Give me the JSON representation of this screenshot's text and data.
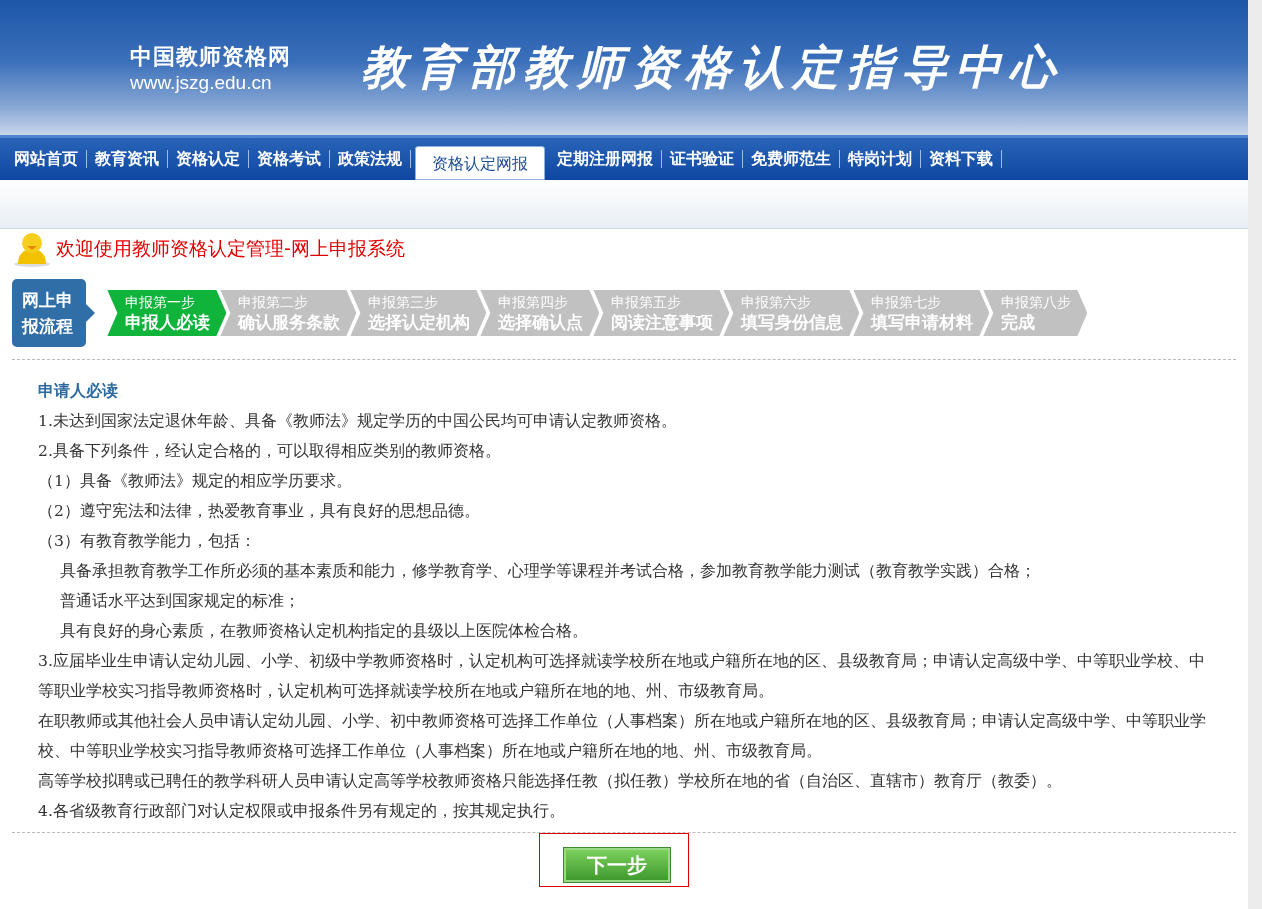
{
  "header": {
    "site_name": "中国教师资格网",
    "site_url": "www.jszg.edu.cn",
    "banner_title": "教育部教师资格认定指导中心"
  },
  "nav": [
    {
      "label": "网站首页",
      "selected": false
    },
    {
      "label": "教育资讯",
      "selected": false
    },
    {
      "label": "资格认定",
      "selected": false
    },
    {
      "label": "资格考试",
      "selected": false
    },
    {
      "label": "政策法规",
      "selected": false
    },
    {
      "label": "资格认定网报",
      "selected": true
    },
    {
      "label": "定期注册网报",
      "selected": false
    },
    {
      "label": "证书验证",
      "selected": false
    },
    {
      "label": "免费师范生",
      "selected": false
    },
    {
      "label": "特岗计划",
      "selected": false
    },
    {
      "label": "资料下载",
      "selected": false
    }
  ],
  "welcome": "欢迎使用教师资格认定管理-网上申报系统",
  "flow_label": "网上申报流程",
  "steps": [
    {
      "step": "申报第一步",
      "title": "申报人必读",
      "selected": true
    },
    {
      "step": "申报第二步",
      "title": "确认服务条款",
      "selected": false
    },
    {
      "step": "申报第三步",
      "title": "选择认定机构",
      "selected": false
    },
    {
      "step": "申报第四步",
      "title": "选择确认点",
      "selected": false
    },
    {
      "step": "申报第五步",
      "title": "阅读注意事项",
      "selected": false
    },
    {
      "step": "申报第六步",
      "title": "填写身份信息",
      "selected": false
    },
    {
      "step": "申报第七步",
      "title": "填写申请材料",
      "selected": false
    },
    {
      "step": "申报第八步",
      "title": "完成",
      "selected": false
    }
  ],
  "notice": [
    {
      "kind": "heading",
      "text": "申请人必读"
    },
    {
      "kind": "para",
      "text": "1.未达到国家法定退休年龄、具备《教师法》规定学历的中国公民均可申请认定教师资格。"
    },
    {
      "kind": "para",
      "text": "2.具备下列条件，经认定合格的，可以取得相应类别的教师资格。"
    },
    {
      "kind": "sub",
      "text": "（1）具备《教师法》规定的相应学历要求。"
    },
    {
      "kind": "sub",
      "text": "（2）遵守宪法和法律，热爱教育事业，具有良好的思想品德。"
    },
    {
      "kind": "sub",
      "text": "（3）有教育教学能力，包括："
    },
    {
      "kind": "indent",
      "text": "具备承担教育教学工作所必须的基本素质和能力，修学教育学、心理学等课程并考试合格，参加教育教学能力测试（教育教学实践）合格；"
    },
    {
      "kind": "indent",
      "text": "普通话水平达到国家规定的标准；"
    },
    {
      "kind": "indent",
      "text": "具有良好的身心素质，在教师资格认定机构指定的县级以上医院体检合格。"
    },
    {
      "kind": "para",
      "text": "3.应届毕业生申请认定幼儿园、小学、初级中学教师资格时，认定机构可选择就读学校所在地或户籍所在地的区、县级教育局；申请认定高级中学、中等职业学校、中等职业学校实习指导教师资格时，认定机构可选择就读学校所在地或户籍所在地的地、州、市级教育局。"
    },
    {
      "kind": "para",
      "text": "在职教师或其他社会人员申请认定幼儿园、小学、初中教师资格可选择工作单位（人事档案）所在地或户籍所在地的区、县级教育局；申请认定高级中学、中等职业学校、中等职业学校实习指导教师资格可选择工作单位（人事档案）所在地或户籍所在地的地、州、市级教育局。"
    },
    {
      "kind": "para",
      "text": "高等学校拟聘或已聘任的教学科研人员申请认定高等学校教师资格只能选择任教（拟任教）学校所在地的省（自治区、直辖市）教育厅（教委）。"
    },
    {
      "kind": "para",
      "text": "4.各省级教育行政部门对认定权限或申报条件另有规定的，按其规定执行。"
    }
  ],
  "next_button": "下一步"
}
